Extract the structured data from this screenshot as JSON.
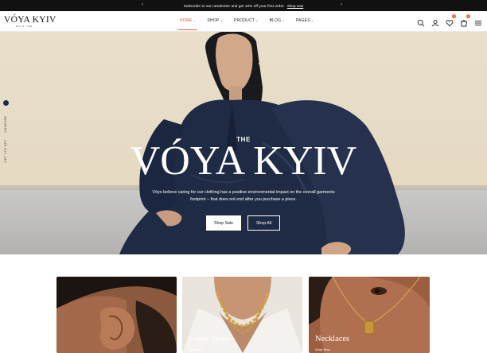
{
  "announcement": {
    "text": "Subscribe to our newsletter and get 10% off your first order.",
    "link": "Shop now"
  },
  "brand": {
    "logo": "VÓYA KYIV",
    "tagline": "EPO & TIME"
  },
  "nav": {
    "items": [
      {
        "label": "HOME",
        "active": true
      },
      {
        "label": "SHOP"
      },
      {
        "label": "PRODUCT"
      },
      {
        "label": "BLOG"
      },
      {
        "label": "PAGES"
      }
    ],
    "cart_count": "0",
    "wishlist_count": "0"
  },
  "side_tab": {
    "compare": "COMPARE",
    "promo": "GET 15% OFF"
  },
  "hero": {
    "the": "THE",
    "title": "VÓYA KYIV",
    "description": "Vôyo believe caring for our clothing has a positive environmental impact on the overall garments footprint – that does not end after you purchase a piece.",
    "primary_button": "Shop Sale",
    "secondary_button": "Shop All"
  },
  "categories": [
    {
      "name": "",
      "cta": ""
    },
    {
      "name": "Loose Stone",
      "cta": "Shop Now"
    },
    {
      "name": "Necklaces",
      "cta": "Shop Now"
    }
  ],
  "colors": {
    "accent": "#e2613a",
    "topbar": "#111111"
  }
}
